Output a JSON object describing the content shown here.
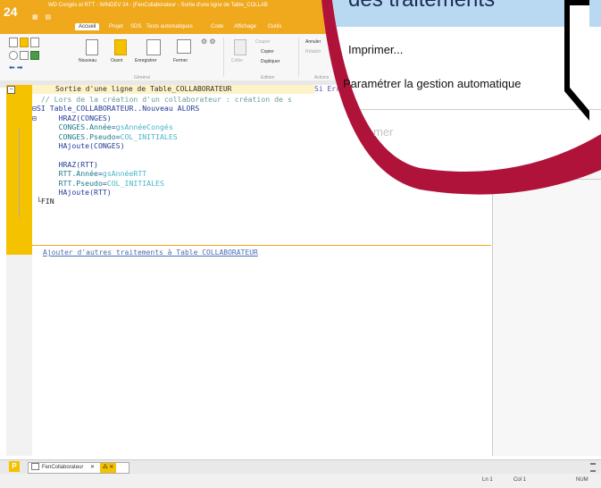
{
  "titlebar": {
    "logo": "24",
    "title": "WD Congés et RTT - WINDEV 24 - [FenCollaborateur - Sortie d'une ligne de Table_COLLAB"
  },
  "tabs": [
    {
      "label": "Accueil",
      "active": true
    },
    {
      "label": "Projet"
    },
    {
      "label": "SDS"
    },
    {
      "label": "Tests automatiques"
    },
    {
      "label": "Code"
    },
    {
      "label": "Affichage"
    },
    {
      "label": "Outils"
    }
  ],
  "ribbon": {
    "new": "Nouveau",
    "open": "Ouvrir",
    "save": "Enregistrer",
    "close": "Fermer",
    "paste": "Coller",
    "cut": "Couper",
    "copy": "Copier",
    "duplicate": "Dupliquer",
    "cancel": "Annuler",
    "redo": "Rétablir",
    "group_general": "Général",
    "group_edition": "Edition",
    "group_actions": "Actions"
  },
  "editor": {
    "header_title": "Sortie d'une ligne de Table_COLLABORATEUR",
    "header_next": "Si Err",
    "comment": "// Lors de la création d'un collaborateur : création de s",
    "line_si": "SI Table_COLLABORATEUR..Nouveau ALORS",
    "add_link": "Ajouter d'autres traitements à Table_COLLABORATEUR"
  },
  "zoom": {
    "heading": "des traitements",
    "menu_print": "Imprimer...",
    "menu_param": "Paramétrer la gestion automatique",
    "menu_disabled": "mer"
  },
  "bottom": {
    "tab_label": "FenCollaborateur",
    "p_label": "P"
  },
  "statusbar": {
    "ln": "Ln 1",
    "col": "Col 1",
    "num": "NUM"
  },
  "colors": {
    "accent": "#f0a81c",
    "gutter": "#f5c200",
    "zoom_ring": "#b0133a",
    "zoom_bg": "#b9d9f2"
  }
}
